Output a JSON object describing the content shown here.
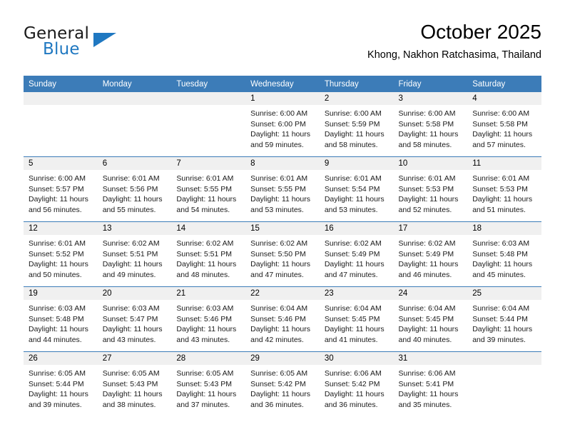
{
  "brand": {
    "word_one": "General",
    "word_two": "Blue",
    "logo_icon": "triangle-logo-icon",
    "accent_color": "#1f78c1"
  },
  "header": {
    "month_title": "October 2025",
    "location": "Khong, Nakhon Ratchasima, Thailand"
  },
  "calendar": {
    "header_bg": "#3c7cb8",
    "daynum_bg": "#f0f0f0",
    "weekdays": [
      "Sunday",
      "Monday",
      "Tuesday",
      "Wednesday",
      "Thursday",
      "Friday",
      "Saturday"
    ],
    "weeks": [
      [
        {
          "day": "",
          "empty": true
        },
        {
          "day": "",
          "empty": true
        },
        {
          "day": "",
          "empty": true
        },
        {
          "day": "1",
          "sunrise": "Sunrise: 6:00 AM",
          "sunset": "Sunset: 6:00 PM",
          "daylight_l1": "Daylight: 11 hours",
          "daylight_l2": "and 59 minutes."
        },
        {
          "day": "2",
          "sunrise": "Sunrise: 6:00 AM",
          "sunset": "Sunset: 5:59 PM",
          "daylight_l1": "Daylight: 11 hours",
          "daylight_l2": "and 58 minutes."
        },
        {
          "day": "3",
          "sunrise": "Sunrise: 6:00 AM",
          "sunset": "Sunset: 5:58 PM",
          "daylight_l1": "Daylight: 11 hours",
          "daylight_l2": "and 58 minutes."
        },
        {
          "day": "4",
          "sunrise": "Sunrise: 6:00 AM",
          "sunset": "Sunset: 5:58 PM",
          "daylight_l1": "Daylight: 11 hours",
          "daylight_l2": "and 57 minutes."
        }
      ],
      [
        {
          "day": "5",
          "sunrise": "Sunrise: 6:00 AM",
          "sunset": "Sunset: 5:57 PM",
          "daylight_l1": "Daylight: 11 hours",
          "daylight_l2": "and 56 minutes."
        },
        {
          "day": "6",
          "sunrise": "Sunrise: 6:01 AM",
          "sunset": "Sunset: 5:56 PM",
          "daylight_l1": "Daylight: 11 hours",
          "daylight_l2": "and 55 minutes."
        },
        {
          "day": "7",
          "sunrise": "Sunrise: 6:01 AM",
          "sunset": "Sunset: 5:55 PM",
          "daylight_l1": "Daylight: 11 hours",
          "daylight_l2": "and 54 minutes."
        },
        {
          "day": "8",
          "sunrise": "Sunrise: 6:01 AM",
          "sunset": "Sunset: 5:55 PM",
          "daylight_l1": "Daylight: 11 hours",
          "daylight_l2": "and 53 minutes."
        },
        {
          "day": "9",
          "sunrise": "Sunrise: 6:01 AM",
          "sunset": "Sunset: 5:54 PM",
          "daylight_l1": "Daylight: 11 hours",
          "daylight_l2": "and 53 minutes."
        },
        {
          "day": "10",
          "sunrise": "Sunrise: 6:01 AM",
          "sunset": "Sunset: 5:53 PM",
          "daylight_l1": "Daylight: 11 hours",
          "daylight_l2": "and 52 minutes."
        },
        {
          "day": "11",
          "sunrise": "Sunrise: 6:01 AM",
          "sunset": "Sunset: 5:53 PM",
          "daylight_l1": "Daylight: 11 hours",
          "daylight_l2": "and 51 minutes."
        }
      ],
      [
        {
          "day": "12",
          "sunrise": "Sunrise: 6:01 AM",
          "sunset": "Sunset: 5:52 PM",
          "daylight_l1": "Daylight: 11 hours",
          "daylight_l2": "and 50 minutes."
        },
        {
          "day": "13",
          "sunrise": "Sunrise: 6:02 AM",
          "sunset": "Sunset: 5:51 PM",
          "daylight_l1": "Daylight: 11 hours",
          "daylight_l2": "and 49 minutes."
        },
        {
          "day": "14",
          "sunrise": "Sunrise: 6:02 AM",
          "sunset": "Sunset: 5:51 PM",
          "daylight_l1": "Daylight: 11 hours",
          "daylight_l2": "and 48 minutes."
        },
        {
          "day": "15",
          "sunrise": "Sunrise: 6:02 AM",
          "sunset": "Sunset: 5:50 PM",
          "daylight_l1": "Daylight: 11 hours",
          "daylight_l2": "and 47 minutes."
        },
        {
          "day": "16",
          "sunrise": "Sunrise: 6:02 AM",
          "sunset": "Sunset: 5:49 PM",
          "daylight_l1": "Daylight: 11 hours",
          "daylight_l2": "and 47 minutes."
        },
        {
          "day": "17",
          "sunrise": "Sunrise: 6:02 AM",
          "sunset": "Sunset: 5:49 PM",
          "daylight_l1": "Daylight: 11 hours",
          "daylight_l2": "and 46 minutes."
        },
        {
          "day": "18",
          "sunrise": "Sunrise: 6:03 AM",
          "sunset": "Sunset: 5:48 PM",
          "daylight_l1": "Daylight: 11 hours",
          "daylight_l2": "and 45 minutes."
        }
      ],
      [
        {
          "day": "19",
          "sunrise": "Sunrise: 6:03 AM",
          "sunset": "Sunset: 5:48 PM",
          "daylight_l1": "Daylight: 11 hours",
          "daylight_l2": "and 44 minutes."
        },
        {
          "day": "20",
          "sunrise": "Sunrise: 6:03 AM",
          "sunset": "Sunset: 5:47 PM",
          "daylight_l1": "Daylight: 11 hours",
          "daylight_l2": "and 43 minutes."
        },
        {
          "day": "21",
          "sunrise": "Sunrise: 6:03 AM",
          "sunset": "Sunset: 5:46 PM",
          "daylight_l1": "Daylight: 11 hours",
          "daylight_l2": "and 43 minutes."
        },
        {
          "day": "22",
          "sunrise": "Sunrise: 6:04 AM",
          "sunset": "Sunset: 5:46 PM",
          "daylight_l1": "Daylight: 11 hours",
          "daylight_l2": "and 42 minutes."
        },
        {
          "day": "23",
          "sunrise": "Sunrise: 6:04 AM",
          "sunset": "Sunset: 5:45 PM",
          "daylight_l1": "Daylight: 11 hours",
          "daylight_l2": "and 41 minutes."
        },
        {
          "day": "24",
          "sunrise": "Sunrise: 6:04 AM",
          "sunset": "Sunset: 5:45 PM",
          "daylight_l1": "Daylight: 11 hours",
          "daylight_l2": "and 40 minutes."
        },
        {
          "day": "25",
          "sunrise": "Sunrise: 6:04 AM",
          "sunset": "Sunset: 5:44 PM",
          "daylight_l1": "Daylight: 11 hours",
          "daylight_l2": "and 39 minutes."
        }
      ],
      [
        {
          "day": "26",
          "sunrise": "Sunrise: 6:05 AM",
          "sunset": "Sunset: 5:44 PM",
          "daylight_l1": "Daylight: 11 hours",
          "daylight_l2": "and 39 minutes."
        },
        {
          "day": "27",
          "sunrise": "Sunrise: 6:05 AM",
          "sunset": "Sunset: 5:43 PM",
          "daylight_l1": "Daylight: 11 hours",
          "daylight_l2": "and 38 minutes."
        },
        {
          "day": "28",
          "sunrise": "Sunrise: 6:05 AM",
          "sunset": "Sunset: 5:43 PM",
          "daylight_l1": "Daylight: 11 hours",
          "daylight_l2": "and 37 minutes."
        },
        {
          "day": "29",
          "sunrise": "Sunrise: 6:05 AM",
          "sunset": "Sunset: 5:42 PM",
          "daylight_l1": "Daylight: 11 hours",
          "daylight_l2": "and 36 minutes."
        },
        {
          "day": "30",
          "sunrise": "Sunrise: 6:06 AM",
          "sunset": "Sunset: 5:42 PM",
          "daylight_l1": "Daylight: 11 hours",
          "daylight_l2": "and 36 minutes."
        },
        {
          "day": "31",
          "sunrise": "Sunrise: 6:06 AM",
          "sunset": "Sunset: 5:41 PM",
          "daylight_l1": "Daylight: 11 hours",
          "daylight_l2": "and 35 minutes."
        },
        {
          "day": "",
          "empty": true
        }
      ]
    ]
  }
}
